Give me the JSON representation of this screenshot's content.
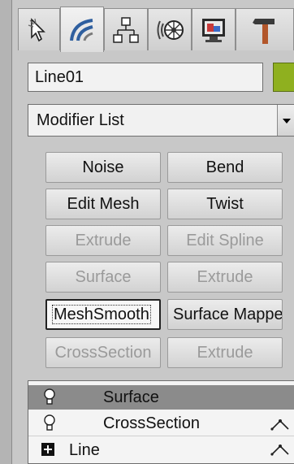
{
  "command_panel": {
    "tabs": [
      {
        "icon": "create-arrow-icon"
      },
      {
        "icon": "modify-icon"
      },
      {
        "icon": "hierarchy-icon"
      },
      {
        "icon": "motion-icon"
      },
      {
        "icon": "display-icon"
      },
      {
        "icon": "utilities-hammer-icon"
      }
    ],
    "object_name": "Line01",
    "object_color": "#8fb01f",
    "modifier_list_label": "Modifier List",
    "modifier_buttons": [
      {
        "label": "Noise",
        "enabled": true
      },
      {
        "label": "Bend",
        "enabled": true
      },
      {
        "label": "Edit Mesh",
        "enabled": true
      },
      {
        "label": "Twist",
        "enabled": true
      },
      {
        "label": "Extrude",
        "enabled": false
      },
      {
        "label": "Edit Spline",
        "enabled": false
      },
      {
        "label": "Surface",
        "enabled": false
      },
      {
        "label": "Extrude",
        "enabled": false
      },
      {
        "label": "MeshSmooth",
        "enabled": true,
        "focused": true
      },
      {
        "label": "Surface Mapper",
        "enabled": true
      },
      {
        "label": "CrossSection",
        "enabled": false
      },
      {
        "label": "Extrude",
        "enabled": false
      }
    ],
    "stack": [
      {
        "label": "Surface",
        "icon": "light-bulb-icon",
        "selected": true
      },
      {
        "label": "CrossSection",
        "icon": "light-bulb-icon",
        "selected": false
      },
      {
        "label": "Line",
        "icon": "expand-plus-icon",
        "selected": false
      }
    ]
  }
}
